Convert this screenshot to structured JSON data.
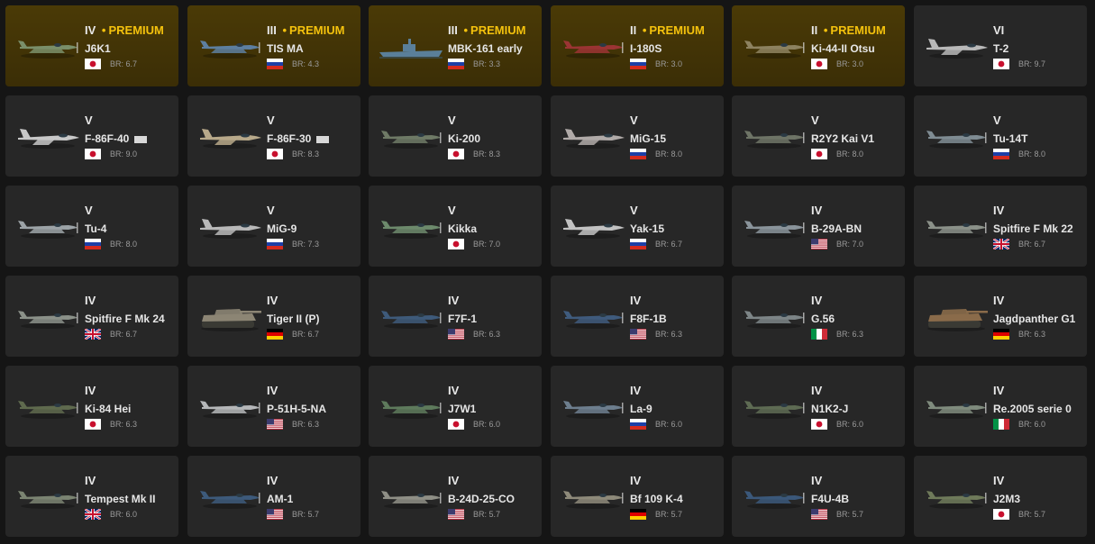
{
  "premium_word": "PREMIUM",
  "br_prefix": "BR: ",
  "colors": {
    "background": "#151515",
    "card": "#272727",
    "card_premium": "#3f3106",
    "premium_text": "#f4c20d",
    "br_text": "#9a9a9a"
  },
  "vehicles": [
    {
      "rank": "IV",
      "premium": true,
      "name": "J6K1",
      "nation": "japan",
      "br": "6.7",
      "kind": "plane",
      "color": "#7a8f6a"
    },
    {
      "rank": "III",
      "premium": true,
      "name": "TIS MA",
      "nation": "russia",
      "br": "4.3",
      "kind": "plane",
      "color": "#5d7fa0"
    },
    {
      "rank": "III",
      "premium": true,
      "name": "MBK-161 early",
      "nation": "russia",
      "br": "3.3",
      "kind": "boat",
      "color": "#5a7f99"
    },
    {
      "rank": "II",
      "premium": true,
      "name": "I-180S",
      "nation": "russia",
      "br": "3.0",
      "kind": "plane",
      "color": "#9b3434"
    },
    {
      "rank": "II",
      "premium": true,
      "name": "Ki-44-II Otsu",
      "nation": "japan",
      "br": "3.0",
      "kind": "plane",
      "color": "#8d8260"
    },
    {
      "rank": "VI",
      "premium": false,
      "name": "T-2",
      "nation": "japan",
      "br": "9.7",
      "kind": "jet",
      "color": "#b9b9b9"
    },
    {
      "rank": "V",
      "premium": false,
      "name": "F-86F-40",
      "badge": true,
      "nation": "japan",
      "br": "9.0",
      "kind": "jet",
      "color": "#c8c8c8"
    },
    {
      "rank": "V",
      "premium": false,
      "name": "F-86F-30",
      "badge": true,
      "nation": "japan",
      "br": "8.3",
      "kind": "jet",
      "color": "#b8a98a"
    },
    {
      "rank": "V",
      "premium": false,
      "name": "Ki-200",
      "nation": "japan",
      "br": "8.3",
      "kind": "plane",
      "color": "#6f7a66"
    },
    {
      "rank": "V",
      "premium": false,
      "name": "MiG-15",
      "nation": "russia",
      "br": "8.0",
      "kind": "jet",
      "color": "#b0aaa8"
    },
    {
      "rank": "V",
      "premium": false,
      "name": "R2Y2 Kai V1",
      "nation": "japan",
      "br": "8.0",
      "kind": "plane",
      "color": "#6e7466"
    },
    {
      "rank": "V",
      "premium": false,
      "name": "Tu-14T",
      "nation": "russia",
      "br": "8.0",
      "kind": "plane",
      "color": "#7f8c93"
    },
    {
      "rank": "V",
      "premium": false,
      "name": "Tu-4",
      "nation": "russia",
      "br": "8.0",
      "kind": "plane",
      "color": "#9ca3a7"
    },
    {
      "rank": "V",
      "premium": false,
      "name": "MiG-9",
      "nation": "russia",
      "br": "7.3",
      "kind": "jet",
      "color": "#b9b9b9"
    },
    {
      "rank": "V",
      "premium": false,
      "name": "Kikka",
      "nation": "japan",
      "br": "7.0",
      "kind": "plane",
      "color": "#6d8a6c"
    },
    {
      "rank": "V",
      "premium": false,
      "name": "Yak-15",
      "nation": "russia",
      "br": "6.7",
      "kind": "jet",
      "color": "#c2c2c2"
    },
    {
      "rank": "IV",
      "premium": false,
      "name": "B-29A-BN",
      "nation": "usa",
      "br": "7.0",
      "kind": "plane",
      "color": "#8a949b"
    },
    {
      "rank": "IV",
      "premium": false,
      "name": "Spitfire F Mk 22",
      "nation": "uk",
      "br": "6.7",
      "kind": "plane",
      "color": "#8b9189"
    },
    {
      "rank": "IV",
      "premium": false,
      "name": "Spitfire F Mk 24",
      "nation": "uk",
      "br": "6.7",
      "kind": "plane",
      "color": "#8b9189"
    },
    {
      "rank": "IV",
      "premium": false,
      "name": "Tiger II (P)",
      "nation": "germany",
      "br": "6.7",
      "kind": "tank",
      "color": "#8c8574"
    },
    {
      "rank": "IV",
      "premium": false,
      "name": "F7F-1",
      "nation": "usa",
      "br": "6.3",
      "kind": "plane",
      "color": "#3e5a7a"
    },
    {
      "rank": "IV",
      "premium": false,
      "name": "F8F-1B",
      "nation": "usa",
      "br": "6.3",
      "kind": "plane",
      "color": "#3f5b7d"
    },
    {
      "rank": "IV",
      "premium": false,
      "name": "G.56",
      "nation": "italy",
      "br": "6.3",
      "kind": "plane",
      "color": "#7d8587"
    },
    {
      "rank": "IV",
      "premium": false,
      "name": "Jagdpanther G1",
      "nation": "germany",
      "br": "6.3",
      "kind": "tank",
      "color": "#8a6b4a"
    },
    {
      "rank": "IV",
      "premium": false,
      "name": "Ki-84 Hei",
      "nation": "japan",
      "br": "6.3",
      "kind": "plane",
      "color": "#5f6a4e"
    },
    {
      "rank": "IV",
      "premium": false,
      "name": "P-51H-5-NA",
      "nation": "usa",
      "br": "6.3",
      "kind": "plane",
      "color": "#b5b7b9"
    },
    {
      "rank": "IV",
      "premium": false,
      "name": "J7W1",
      "nation": "japan",
      "br": "6.0",
      "kind": "plane",
      "color": "#5e7a5c"
    },
    {
      "rank": "IV",
      "premium": false,
      "name": "La-9",
      "nation": "russia",
      "br": "6.0",
      "kind": "plane",
      "color": "#6d7e8e"
    },
    {
      "rank": "IV",
      "premium": false,
      "name": "N1K2-J",
      "nation": "japan",
      "br": "6.0",
      "kind": "plane",
      "color": "#5e6b53"
    },
    {
      "rank": "IV",
      "premium": false,
      "name": "Re.2005 serie 0",
      "nation": "italy",
      "br": "6.0",
      "kind": "plane",
      "color": "#7f8b7d"
    },
    {
      "rank": "IV",
      "premium": false,
      "name": "Tempest Mk II",
      "nation": "uk",
      "br": "6.0",
      "kind": "plane",
      "color": "#7b8472"
    },
    {
      "rank": "IV",
      "premium": false,
      "name": "AM-1",
      "nation": "usa",
      "br": "5.7",
      "kind": "plane",
      "color": "#3d5a7b"
    },
    {
      "rank": "IV",
      "premium": false,
      "name": "B-24D-25-CO",
      "nation": "usa",
      "br": "5.7",
      "kind": "plane",
      "color": "#8f8f86"
    },
    {
      "rank": "IV",
      "premium": false,
      "name": "Bf 109 K-4",
      "nation": "germany",
      "br": "5.7",
      "kind": "plane",
      "color": "#8e8a7a"
    },
    {
      "rank": "IV",
      "premium": false,
      "name": "F4U-4B",
      "nation": "usa",
      "br": "5.7",
      "kind": "plane",
      "color": "#3b587a"
    },
    {
      "rank": "IV",
      "premium": false,
      "name": "J2M3",
      "nation": "japan",
      "br": "5.7",
      "kind": "plane",
      "color": "#6f7a5a"
    }
  ]
}
